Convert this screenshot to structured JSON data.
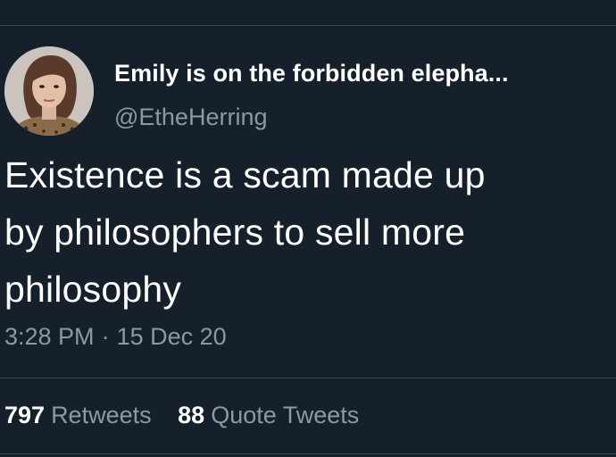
{
  "tweet": {
    "author": {
      "display_name": "Emily is on the forbidden elepha...",
      "handle": "@EtheHerring",
      "avatar_icon": "profile-photo"
    },
    "text_lines": [
      "Existence is a scam made up",
      "by philosophers to sell more",
      "philosophy"
    ],
    "time": "3:28 PM",
    "separator": "·",
    "date": "15 Dec 20",
    "stats": {
      "retweets_count": "797",
      "retweets_label": "Retweets",
      "quote_tweets_count": "88",
      "quote_tweets_label": "Quote Tweets"
    }
  },
  "colors": {
    "background": "#15202b",
    "primary_text": "#ffffff",
    "secondary_text": "#8b98a5",
    "divider": "#38444d"
  }
}
